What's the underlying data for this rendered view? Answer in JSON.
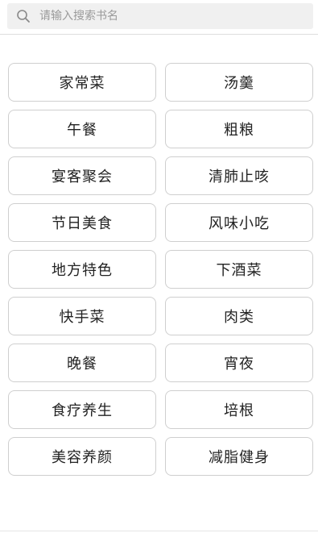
{
  "search": {
    "placeholder": "请输入搜索书名",
    "icon": "search-icon"
  },
  "categories": [
    {
      "label": "家常菜"
    },
    {
      "label": "汤羹"
    },
    {
      "label": "午餐"
    },
    {
      "label": "粗粮"
    },
    {
      "label": "宴客聚会"
    },
    {
      "label": "清肺止咳"
    },
    {
      "label": "节日美食"
    },
    {
      "label": "风味小吃"
    },
    {
      "label": "地方特色"
    },
    {
      "label": "下酒菜"
    },
    {
      "label": "快手菜"
    },
    {
      "label": "肉类"
    },
    {
      "label": "晚餐"
    },
    {
      "label": "宵夜"
    },
    {
      "label": "食疗养生"
    },
    {
      "label": "培根"
    },
    {
      "label": "美容养颜"
    },
    {
      "label": "减脂健身"
    }
  ]
}
